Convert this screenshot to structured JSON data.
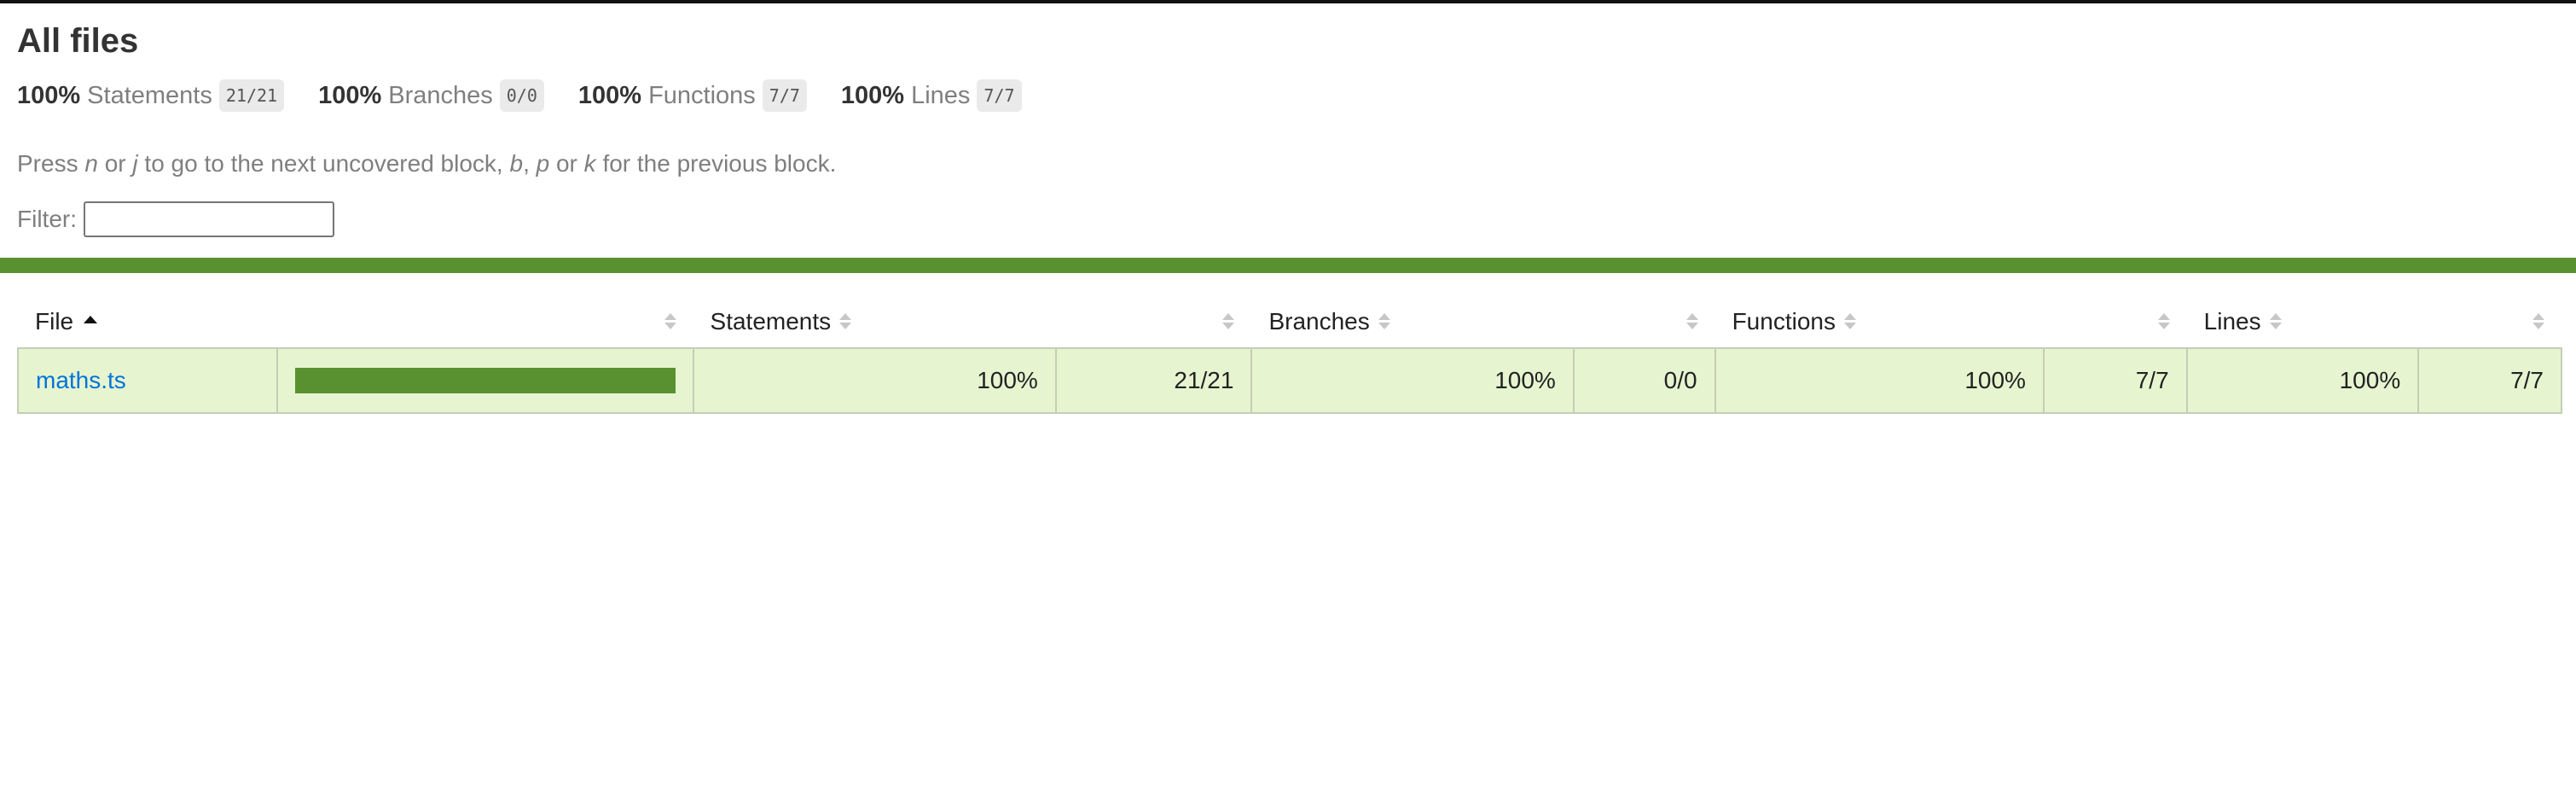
{
  "header": {
    "title": "All files"
  },
  "summary": [
    {
      "percent": "100%",
      "label": "Statements",
      "fraction": "21/21"
    },
    {
      "percent": "100%",
      "label": "Branches",
      "fraction": "0/0"
    },
    {
      "percent": "100%",
      "label": "Functions",
      "fraction": "7/7"
    },
    {
      "percent": "100%",
      "label": "Lines",
      "fraction": "7/7"
    }
  ],
  "hint": {
    "p1": "Press ",
    "k1": "n",
    "p2": " or ",
    "k2": "j",
    "p3": " to go to the next uncovered block, ",
    "k3": "b",
    "p4": ", ",
    "k4": "p",
    "p5": " or ",
    "k5": "k",
    "p6": " for the previous block."
  },
  "filter": {
    "label": "Filter:",
    "value": ""
  },
  "colors": {
    "high": "#5a9130",
    "row_bg": "#e6f5d0",
    "link": "#0074d9"
  },
  "table": {
    "headers": {
      "file": "File",
      "statements": "Statements",
      "branches": "Branches",
      "functions": "Functions",
      "lines": "Lines"
    },
    "sort": {
      "column": "File",
      "direction": "ascending"
    },
    "rows": [
      {
        "file": "maths.ts",
        "coverage_fraction": 1.0,
        "statements_pct": "100%",
        "statements_frac": "21/21",
        "branches_pct": "100%",
        "branches_frac": "0/0",
        "functions_pct": "100%",
        "functions_frac": "7/7",
        "lines_pct": "100%",
        "lines_frac": "7/7"
      }
    ]
  }
}
